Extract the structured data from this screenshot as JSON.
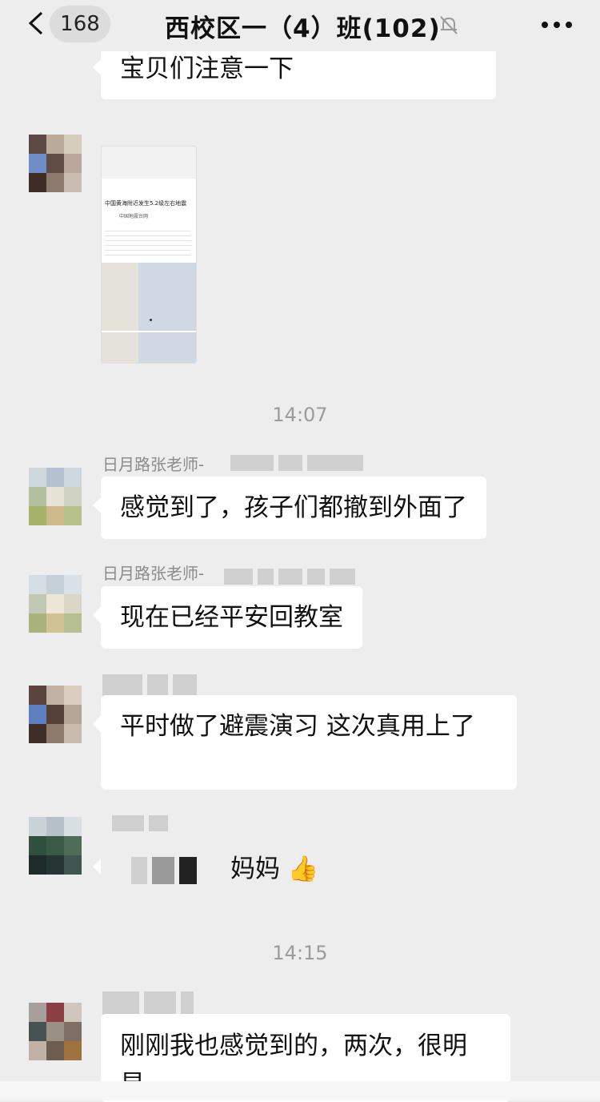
{
  "header": {
    "back_badge": "168",
    "title": "西校区一（4）班(102)"
  },
  "messages": [
    {
      "text": "宝贝们注意一下"
    },
    {
      "time": "14:07"
    },
    {
      "sender": "日月路张老师-",
      "text": "感觉到了，孩子们都撤到外面了"
    },
    {
      "sender": "日月路张老师-",
      "text": "现在已经平安回教室"
    },
    {
      "text": "平时做了避震演习 这次真用上了"
    },
    {
      "text_suffix": "妈妈 👍"
    },
    {
      "time": "14:15"
    },
    {
      "text": "刚刚我也感觉到的，两次，很明显"
    }
  ],
  "thumbnail": {
    "headline": "中国黄海附近发生5.2级左右地震",
    "source": "中国地震台网"
  },
  "icons": {
    "back": "back-chevron-icon",
    "mute": "mute-bell-icon",
    "more": "more-dots-icon"
  }
}
